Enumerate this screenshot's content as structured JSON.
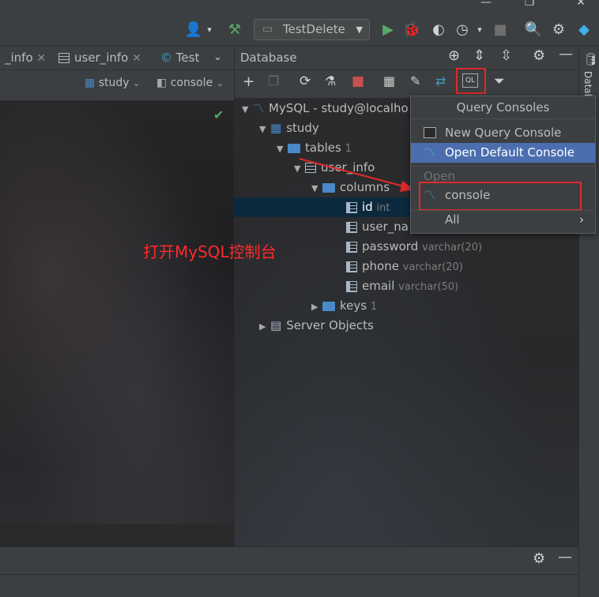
{
  "toolbar": {
    "run_config": "TestDelete"
  },
  "editor_tabs": [
    {
      "label": "_info"
    },
    {
      "label": "user_info"
    },
    {
      "label": "Test"
    }
  ],
  "editor_subbar": {
    "schema": "study",
    "console": "console"
  },
  "db_panel": {
    "title": "Database"
  },
  "tree": {
    "datasource": "MySQL - study@localho",
    "schema": "study",
    "tables_label": "tables",
    "tables_count": "1",
    "table": "user_info",
    "columns_label": "columns",
    "columns": [
      {
        "name": "id",
        "type": "int"
      },
      {
        "name": "user_na",
        "type": ""
      },
      {
        "name": "password",
        "type": "varchar(20)"
      },
      {
        "name": "phone",
        "type": "varchar(20)"
      },
      {
        "name": "email",
        "type": "varchar(50)"
      }
    ],
    "keys_label": "keys",
    "keys_count": "1",
    "server_objects": "Server Objects"
  },
  "popup": {
    "title": "Query Consoles",
    "new_console": "New Query Console",
    "open_default": "Open Default Console",
    "open_section": "Open",
    "console_item": "console",
    "all": "All"
  },
  "annotation": {
    "text": "打开MySQL控制台"
  },
  "right_strip": {
    "label": "Datab"
  }
}
